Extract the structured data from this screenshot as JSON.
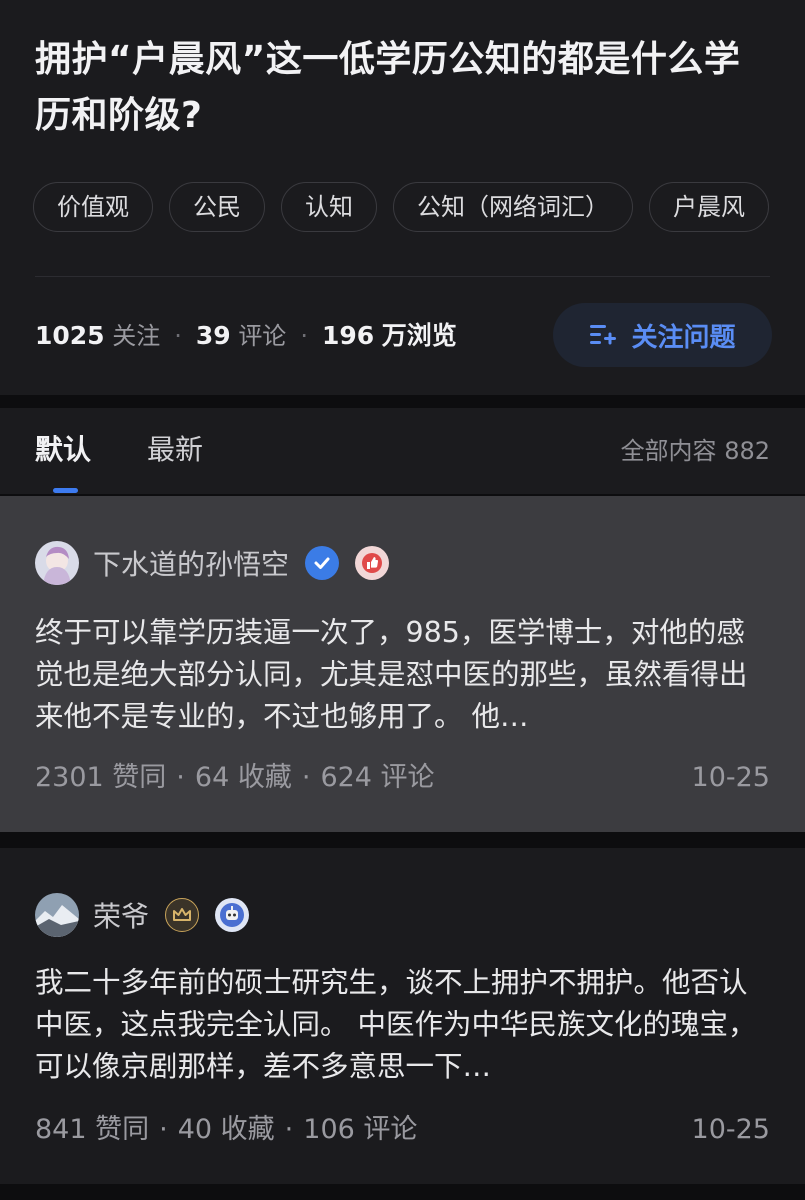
{
  "question": {
    "title": "拥护“户晨风”这一低学历公知的都是什么学历和阶级?",
    "tags": [
      "价值观",
      "公民",
      "认知",
      "公知（网络词汇）",
      "户晨风"
    ],
    "stats": {
      "followers": "1025",
      "followers_label": "关注",
      "comments": "39",
      "comments_label": "评论",
      "views": "196",
      "views_label": "万浏览"
    },
    "follow_button": "关注问题"
  },
  "tabs": {
    "default": "默认",
    "latest": "最新",
    "all_count": "全部内容 882"
  },
  "answers": [
    {
      "author": "下水道的孙悟空",
      "badges": [
        "verified-check-icon",
        "thumb-up-badge-icon"
      ],
      "excerpt": "终于可以靠学历装逼一次了，985，医学博士，对他的感觉也是绝大部分认同，尤其是怼中医的那些，虽然看得出来他不是专业的，不过也够用了。 他…",
      "upvotes": "2301 赞同",
      "favorites": "64 收藏",
      "comments": "624 评论",
      "date": "10-25"
    },
    {
      "author": "荣爷",
      "badges": [
        "crown-badge-icon",
        "robot-badge-icon"
      ],
      "excerpt": "我二十多年前的硕士研究生，谈不上拥护不拥护。他否认中医，这点我完全认同。 中医作为中华民族文化的瑰宝，可以像京剧那样，差不多意思一下…",
      "upvotes": "841 赞同",
      "favorites": "40 收藏",
      "comments": "106 评论",
      "date": "10-25"
    }
  ],
  "colors": {
    "accent": "#3d7bf0",
    "background": "#1b1b1e",
    "highlight_card": "#3c3c40"
  }
}
